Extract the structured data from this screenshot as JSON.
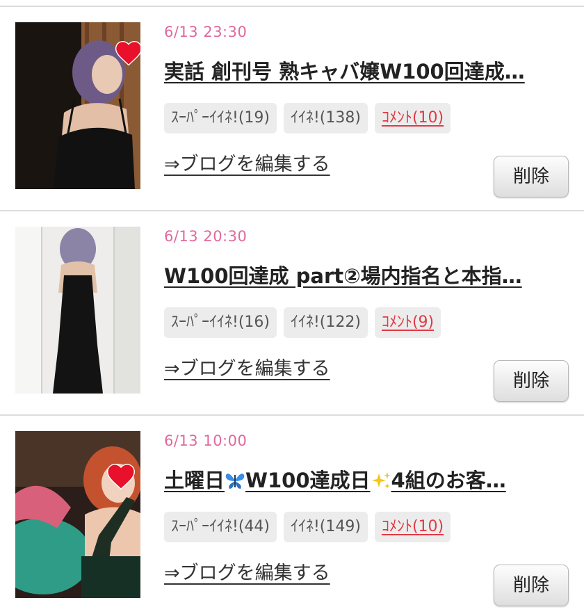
{
  "entries": [
    {
      "date": "6/13 23:30",
      "title": "実話 創刊号 熟キャバ嬢W100回達成…",
      "super_like": "ｽｰﾊﾟｰｲｲﾈ!(19)",
      "like": "ｲｲﾈ!(138)",
      "comment": "ｺﾒﾝﾄ(10)",
      "edit_label": "⇒ブログを編集する",
      "delete_label": "削除"
    },
    {
      "date": "6/13 20:30",
      "title": "W100回達成 part②場内指名と本指…",
      "super_like": "ｽｰﾊﾟｰｲｲﾈ!(16)",
      "like": "ｲｲﾈ!(122)",
      "comment": "ｺﾒﾝﾄ(9)",
      "edit_label": "⇒ブログを編集する",
      "delete_label": "削除"
    },
    {
      "date": "6/13 10:00",
      "title_part1": "土曜日",
      "title_part2": "W100達成日",
      "title_part3": "4組のお客…",
      "super_like": "ｽｰﾊﾟｰｲｲﾈ!(44)",
      "like": "ｲｲﾈ!(149)",
      "comment": "ｺﾒﾝﾄ(10)",
      "edit_label": "⇒ブログを編集する",
      "delete_label": "削除"
    }
  ],
  "icons": {
    "title_emoji_1": "butterfly-icon",
    "title_emoji_2": "sparkles-icon",
    "photo_sticker": "heart-icon"
  },
  "colors": {
    "date": "#e0699b",
    "comment": "#e03a44",
    "heart": "#e8102a",
    "butterfly": "#3a8ee6",
    "sparkles": "#f5c518"
  }
}
